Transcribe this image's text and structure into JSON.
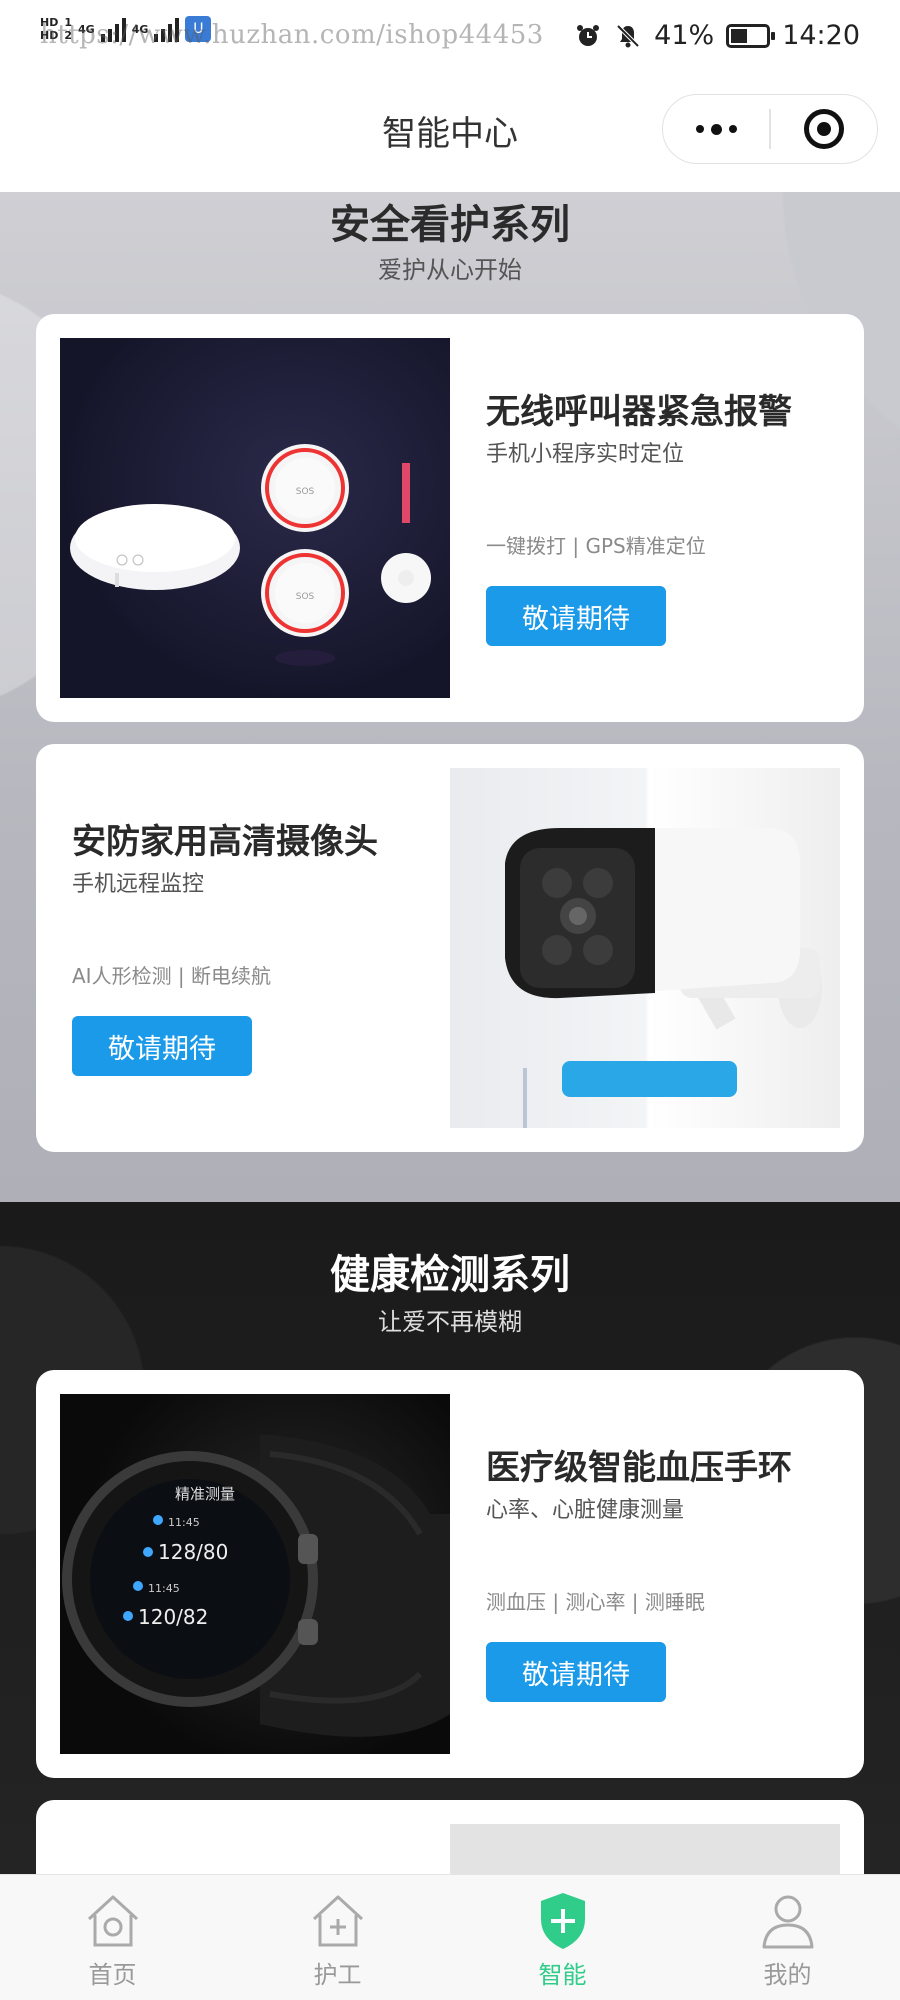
{
  "status_bar": {
    "left_badges": [
      "HD",
      "HD"
    ],
    "left_small": [
      "1",
      "2"
    ],
    "network_1": "4G",
    "network_2": "4G",
    "watermark": "https://www.huzhan.com/ishop44453",
    "battery_percent": "41%",
    "battery_level": 0.41,
    "time": "14:20",
    "icons": [
      "alarm-icon",
      "mute-icon",
      "battery-icon"
    ]
  },
  "nav": {
    "title": "智能中心"
  },
  "sections": [
    {
      "title": "安全看护系列",
      "subtitle": "爱护从心开始",
      "products": [
        {
          "name": "无线呼叫器紧急报警",
          "desc": "手机小程序实时定位",
          "tags": "一键拨打 | GPS精准定位",
          "button": "敬请期待",
          "image_text": [
            "SOS",
            "SOS"
          ]
        },
        {
          "name": "安防家用高清摄像头",
          "desc": "手机远程监控",
          "tags": "AI人形检测 | 断电续航",
          "button": "敬请期待"
        }
      ]
    },
    {
      "title": "健康检测系列",
      "subtitle": "让爱不再模糊",
      "products": [
        {
          "name": "医疗级智能血压手环",
          "desc": "心率、心脏健康测量",
          "tags": "测血压 | 测心率 | 测睡眠",
          "button": "敬请期待",
          "watch_screen": {
            "heading": "精准测量",
            "readings": [
              {
                "time": "11:45",
                "value": "128/80"
              },
              {
                "time": "11:45",
                "value": "120/82"
              }
            ]
          }
        }
      ]
    }
  ],
  "tabs": [
    {
      "label": "首页",
      "icon": "home-icon",
      "active": false
    },
    {
      "label": "护工",
      "icon": "caregiver-icon",
      "active": false
    },
    {
      "label": "智能",
      "icon": "shield-plus-icon",
      "active": true
    },
    {
      "label": "我的",
      "icon": "profile-icon",
      "active": false
    }
  ],
  "colors": {
    "accent_button": "#1a9ae8",
    "active_tab": "#2fcc8a",
    "inactive_tab": "#999999"
  }
}
